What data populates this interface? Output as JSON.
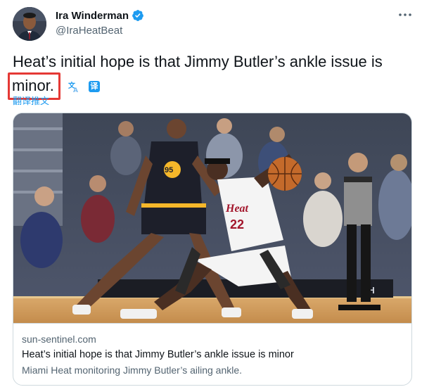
{
  "author": {
    "display_name": "Ira Winderman",
    "handle": "@IraHeatBeat",
    "verified": true
  },
  "tweet": {
    "text_line1": "Heat’s initial hope is that Jimmy Butler’s ankle issue is",
    "text_line2": "minor.",
    "translate_link": "翻译推文",
    "translate_badge": "译"
  },
  "card": {
    "domain": "sun-sentinel.com",
    "title": "Heat’s initial hope is that Jimmy Butler’s ankle issue is minor",
    "description": "Miami Heat monitoring Jimmy Butler’s ailing ankle.",
    "photo_jersey_left_number": "95",
    "photo_jersey_right_text": "Heat",
    "photo_jersey_right_number": "22",
    "photo_court_text": "CH"
  },
  "icons": {
    "verified": "verified-badge-icon",
    "more": "more-options-icon",
    "translate_glyph": "translate-glyph-icon",
    "translate_badge": "translate-badge-icon"
  },
  "colors": {
    "accent_blue": "#1d9bf0",
    "highlight_red": "#e53935",
    "text_primary": "#0f1419",
    "text_secondary": "#536471",
    "card_border": "#cfd9de"
  }
}
